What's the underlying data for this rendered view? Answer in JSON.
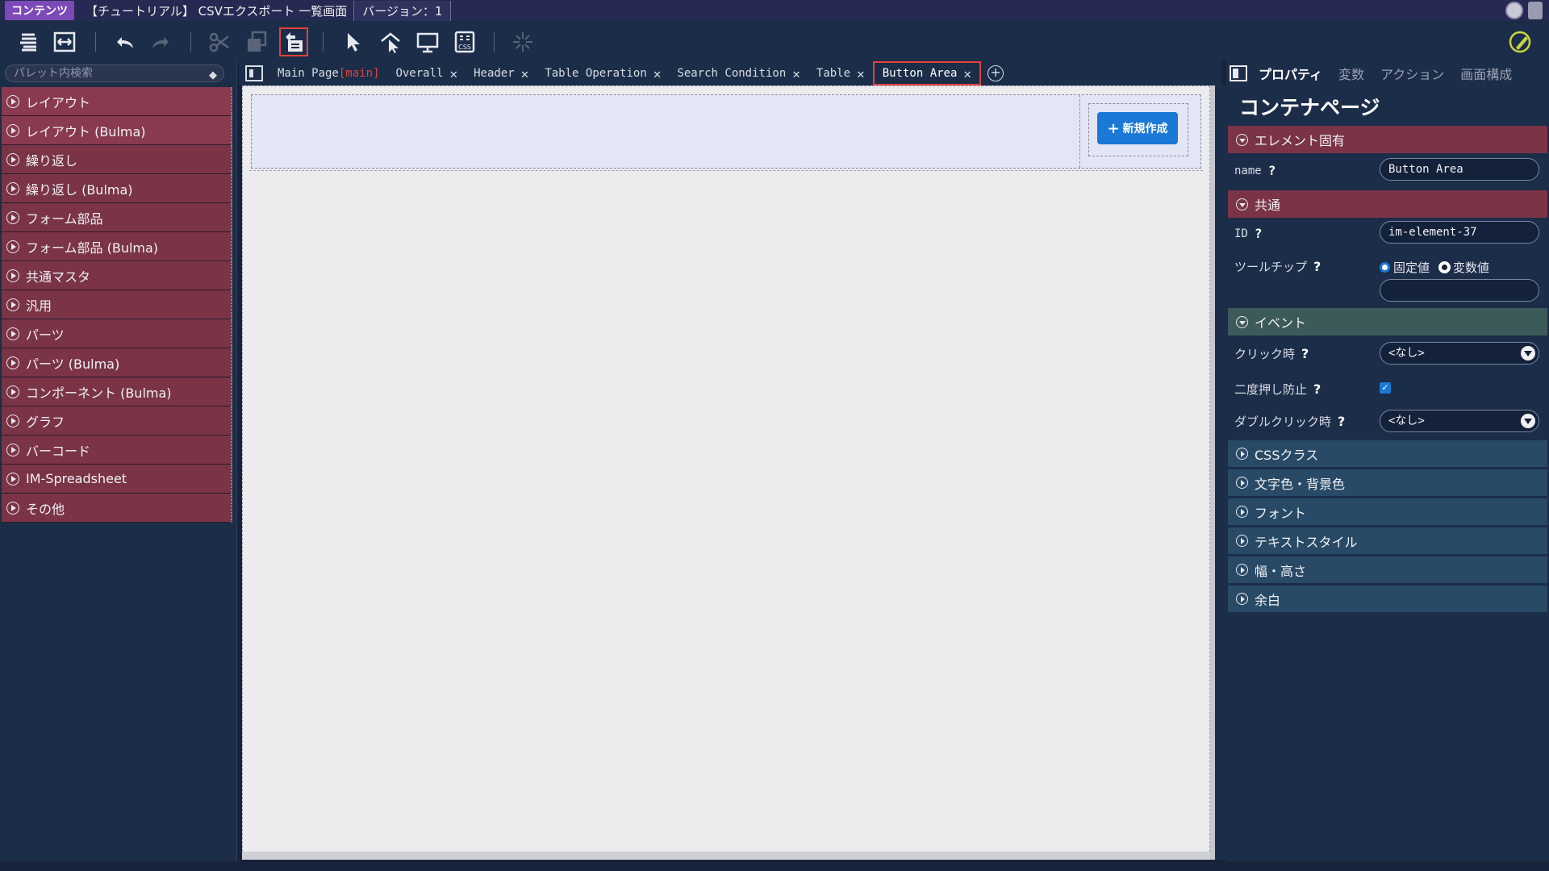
{
  "titlebar": {
    "app_label": "コンテンツ",
    "document_title": "【チュートリアル】 CSVエクスポート 一覧画面",
    "version_label": "バージョン：1"
  },
  "toolbar": {
    "buttons": [
      {
        "name": "palette-icon",
        "active": false
      },
      {
        "name": "fit-icon",
        "active": false
      },
      {
        "name": "undo-icon",
        "active": false
      },
      {
        "name": "redo-icon",
        "active": false
      },
      {
        "name": "cut-icon",
        "active": false
      },
      {
        "name": "copy-icon",
        "active": false
      },
      {
        "name": "paste-icon",
        "active": true
      },
      {
        "name": "select-icon",
        "active": false
      },
      {
        "name": "select-parent-icon",
        "active": false
      },
      {
        "name": "preview-icon",
        "active": false
      },
      {
        "name": "css-icon",
        "active": false
      },
      {
        "name": "sparkle-icon",
        "active": false
      },
      {
        "name": "pencil-check-icon",
        "active": false
      }
    ]
  },
  "palette": {
    "search_placeholder": "パレット内検索",
    "items": [
      {
        "label": "レイアウト",
        "color": "#8a3a4e"
      },
      {
        "label": "レイアウト (Bulma)",
        "color": "#8a3a4e"
      },
      {
        "label": "繰り返し",
        "color": "#7a3446"
      },
      {
        "label": "繰り返し (Bulma)",
        "color": "#7a3446"
      },
      {
        "label": "フォーム部品",
        "color": "#7a3446"
      },
      {
        "label": "フォーム部品 (Bulma)",
        "color": "#7a3446"
      },
      {
        "label": "共通マスタ",
        "color": "#7a3446"
      },
      {
        "label": "汎用",
        "color": "#7a3446"
      },
      {
        "label": "パーツ",
        "color": "#7a3446"
      },
      {
        "label": "パーツ (Bulma)",
        "color": "#7a3446"
      },
      {
        "label": "コンポーネント (Bulma)",
        "color": "#7a3446"
      },
      {
        "label": "グラフ",
        "color": "#7a3446"
      },
      {
        "label": "バーコード",
        "color": "#7a3446"
      },
      {
        "label": "IM-Spreadsheet",
        "color": "#7a3446"
      },
      {
        "label": "その他",
        "color": "#7a3446"
      }
    ]
  },
  "tabs": [
    {
      "label": "Main Page",
      "tag": "[main]",
      "closable": false,
      "active": false
    },
    {
      "label": "Overall",
      "closable": true,
      "active": false
    },
    {
      "label": "Header",
      "closable": true,
      "active": false
    },
    {
      "label": "Table Operation",
      "closable": true,
      "active": false
    },
    {
      "label": "Search Condition",
      "closable": true,
      "active": false
    },
    {
      "label": "Table",
      "closable": true,
      "active": false
    },
    {
      "label": "Button Area",
      "closable": true,
      "active": true
    }
  ],
  "canvas": {
    "new_button_label": "新規作成"
  },
  "props": {
    "tabs": [
      {
        "label": "プロパティ",
        "active": true
      },
      {
        "label": "変数",
        "active": false
      },
      {
        "label": "アクション",
        "active": false
      },
      {
        "label": "画面構成",
        "active": false
      }
    ],
    "title": "コンテナページ",
    "sections": {
      "element": "エレメント固有",
      "common": "共通",
      "event": "イベント",
      "css": "CSSクラス",
      "color": "文字色・背景色",
      "font": "フォント",
      "textstyle": "テキストスタイル",
      "size": "幅・高さ",
      "margin": "余白"
    },
    "fields": {
      "name_label": "name",
      "name_value": "Button Area",
      "id_label": "ID",
      "id_value": "im-element-37",
      "tooltip_label": "ツールチップ",
      "tooltip_fixed": "固定値",
      "tooltip_variable": "変数値",
      "tooltip_value": "",
      "click_label": "クリック時",
      "click_value": "<なし>",
      "double_submit_label": "二度押し防止",
      "double_submit_checked": true,
      "dblclick_label": "ダブルクリック時",
      "dblclick_value": "<なし>"
    },
    "qmark": "?"
  }
}
